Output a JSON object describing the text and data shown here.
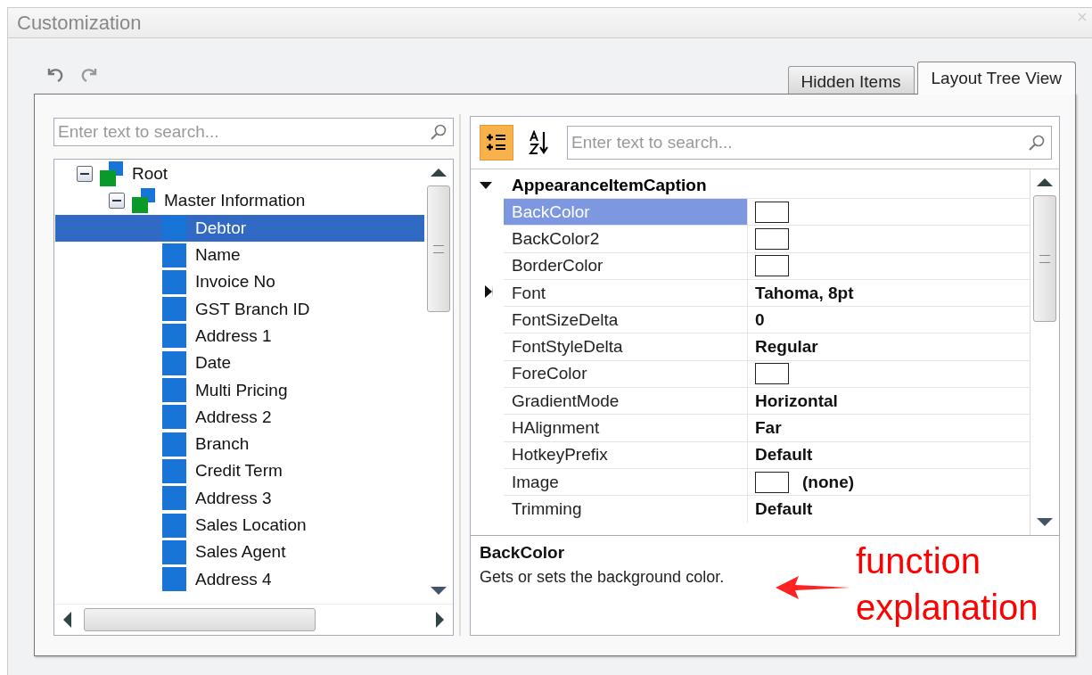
{
  "window": {
    "title": "Customization"
  },
  "tabs": [
    {
      "label": "Hidden Items",
      "selected": false
    },
    {
      "label": "Layout Tree View",
      "selected": true
    }
  ],
  "tree_search": {
    "placeholder": "Enter text to search..."
  },
  "tree": [
    {
      "label": "Root",
      "expanded": true,
      "selected": false,
      "children": [
        {
          "label": "Master Information",
          "expanded": true,
          "selected": false,
          "children": [
            {
              "label": "Debtor",
              "selected": true
            },
            {
              "label": "Name",
              "selected": false
            },
            {
              "label": "Invoice No",
              "selected": false
            },
            {
              "label": "GST Branch ID",
              "selected": false
            },
            {
              "label": "Address 1",
              "selected": false
            },
            {
              "label": "Date",
              "selected": false
            },
            {
              "label": "Multi Pricing",
              "selected": false
            },
            {
              "label": "Address 2",
              "selected": false
            },
            {
              "label": "Branch",
              "selected": false
            },
            {
              "label": "Credit Term",
              "selected": false
            },
            {
              "label": "Address 3",
              "selected": false
            },
            {
              "label": "Sales Location",
              "selected": false
            },
            {
              "label": "Sales Agent",
              "selected": false
            },
            {
              "label": "Address 4",
              "selected": false
            }
          ]
        }
      ]
    }
  ],
  "property_toolbar": [
    {
      "kind": "categorized",
      "selected": true
    },
    {
      "kind": "alphabetical",
      "selected": false
    }
  ],
  "property_search": {
    "placeholder": "Enter text to search..."
  },
  "property_grid": {
    "category": "AppearanceItemCaption",
    "expanded": true,
    "rows": [
      {
        "name": "BackColor",
        "kind": "color",
        "selected": true,
        "collapsed": false
      },
      {
        "name": "BackColor2",
        "kind": "color",
        "selected": false,
        "collapsed": false
      },
      {
        "name": "BorderColor",
        "kind": "color",
        "selected": false,
        "collapsed": false
      },
      {
        "name": "Font",
        "kind": "text",
        "value": "Tahoma, 8pt",
        "selected": false,
        "collapsed": true
      },
      {
        "name": "FontSizeDelta",
        "kind": "text",
        "value": "0",
        "selected": false,
        "collapsed": false
      },
      {
        "name": "FontStyleDelta",
        "kind": "text",
        "value": "Regular",
        "selected": false,
        "collapsed": false
      },
      {
        "name": "ForeColor",
        "kind": "color",
        "selected": false,
        "collapsed": false
      },
      {
        "name": "GradientMode",
        "kind": "text",
        "value": "Horizontal",
        "selected": false,
        "collapsed": false
      },
      {
        "name": "HAlignment",
        "kind": "text",
        "value": "Far",
        "selected": false,
        "collapsed": false
      },
      {
        "name": "HotkeyPrefix",
        "kind": "text",
        "value": "Default",
        "selected": false,
        "collapsed": false
      },
      {
        "name": "Image",
        "kind": "image",
        "value": "(none)",
        "selected": false,
        "collapsed": false
      },
      {
        "name": "Trimming",
        "kind": "text",
        "value": "Default",
        "selected": false,
        "collapsed": false
      }
    ]
  },
  "description": {
    "title": "BackColor",
    "text": "Gets or sets the background color."
  },
  "annotation": {
    "lines": [
      "function",
      "explanation"
    ]
  }
}
